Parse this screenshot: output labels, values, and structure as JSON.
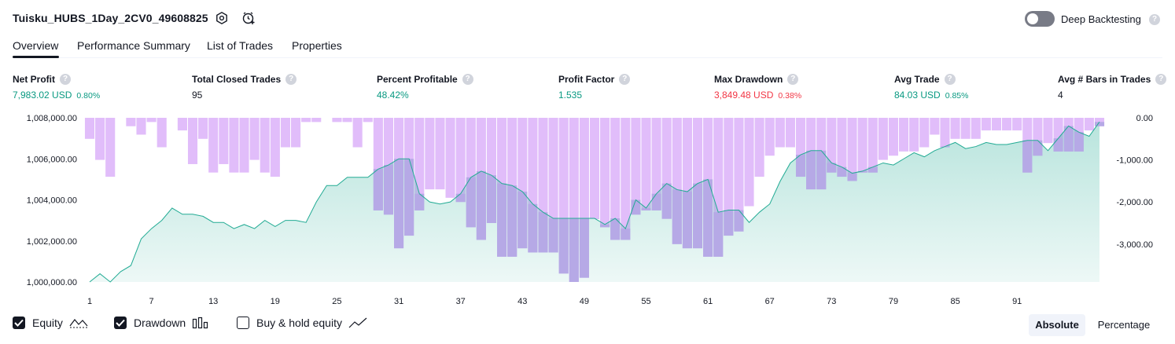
{
  "header": {
    "title": "Tuisku_HUBS_1Day_2CV0_49608825",
    "settings_icon": "gear-icon",
    "alert_icon": "add-alert-icon",
    "deep_backtesting_label": "Deep Backtesting",
    "deep_backtesting_enabled": false,
    "help_glyph": "?"
  },
  "tabs": [
    {
      "label": "Overview",
      "active": true
    },
    {
      "label": "Performance Summary",
      "active": false
    },
    {
      "label": "List of Trades",
      "active": false
    },
    {
      "label": "Properties",
      "active": false
    }
  ],
  "metrics": [
    {
      "label": "Net Profit",
      "value": "7,983.02 USD",
      "pct": "0.80%",
      "tone": "pos"
    },
    {
      "label": "Total Closed Trades",
      "value": "95",
      "pct": "",
      "tone": "neutral"
    },
    {
      "label": "Percent Profitable",
      "value": "48.42%",
      "pct": "",
      "tone": "pos"
    },
    {
      "label": "Profit Factor",
      "value": "1.535",
      "pct": "",
      "tone": "pos"
    },
    {
      "label": "Max Drawdown",
      "value": "3,849.48 USD",
      "pct": "0.38%",
      "tone": "neg"
    },
    {
      "label": "Avg Trade",
      "value": "84.03 USD",
      "pct": "0.85%",
      "tone": "pos"
    },
    {
      "label": "Avg # Bars in Trades",
      "value": "4",
      "pct": "",
      "tone": "neutral"
    }
  ],
  "chart_data": {
    "type": "line",
    "x_ticks": [
      "1",
      "7",
      "13",
      "19",
      "25",
      "31",
      "37",
      "43",
      "49",
      "55",
      "61",
      "67",
      "73",
      "79",
      "85",
      "91"
    ],
    "left_ticks": [
      "1,008,000.00",
      "1,006,000.00",
      "1,004,000.00",
      "1,002,000.00",
      "1,000,000.00"
    ],
    "right_ticks": [
      "0.00",
      "-1,000.00",
      "-2,000.00",
      "-3,000.00"
    ],
    "left_ylim": [
      1000000,
      1008000
    ],
    "right_ylim": [
      -3900,
      0
    ],
    "series": [
      {
        "name": "Equity",
        "axis": "left",
        "color": "#22ab94",
        "values": [
          1000000,
          1000400,
          1000000,
          1000500,
          1000800,
          1002100,
          1002600,
          1003000,
          1003600,
          1003300,
          1003300,
          1003200,
          1002900,
          1002900,
          1002600,
          1002800,
          1002600,
          1003000,
          1002700,
          1003000,
          1003000,
          1002900,
          1003900,
          1004700,
          1004700,
          1005100,
          1005100,
          1005100,
          1005500,
          1005700,
          1006000,
          1006000,
          1004300,
          1003900,
          1003800,
          1003900,
          1004300,
          1005100,
          1005400,
          1005200,
          1004800,
          1004700,
          1004400,
          1003800,
          1003400,
          1003100,
          1003100,
          1003100,
          1003100,
          1003100,
          1002800,
          1003100,
          1002600,
          1004000,
          1003600,
          1004300,
          1004800,
          1004500,
          1004400,
          1004800,
          1005000,
          1003400,
          1003500,
          1003500,
          1002900,
          1003400,
          1003800,
          1004900,
          1005800,
          1006200,
          1006400,
          1006400,
          1005800,
          1005600,
          1005300,
          1005400,
          1005600,
          1005800,
          1005700,
          1006000,
          1006300,
          1006100,
          1006400,
          1006600,
          1006800,
          1006500,
          1006600,
          1006800,
          1006700,
          1006700,
          1006800,
          1006900,
          1006900,
          1006400,
          1007000,
          1007600,
          1007300,
          1007100,
          1007800,
          1008000
        ]
      },
      {
        "name": "Drawdown",
        "axis": "right",
        "color": "#e1bdfa",
        "values": [
          -500,
          -1000,
          -1400,
          0,
          -200,
          -400,
          -100,
          -700,
          0,
          -300,
          -1100,
          -500,
          -1300,
          -1100,
          -1300,
          -1300,
          -1000,
          -1300,
          -1400,
          -700,
          -700,
          -100,
          -100,
          0,
          -100,
          -100,
          -700,
          -100,
          -2200,
          -2300,
          -3100,
          -2800,
          -2200,
          -1700,
          -1700,
          -1900,
          -2000,
          -2600,
          -2900,
          -2500,
          -3300,
          -3300,
          -3100,
          -3200,
          -3200,
          -3200,
          -3700,
          -3900,
          -3800,
          -2400,
          -2600,
          -2900,
          -2900,
          -2300,
          -2200,
          -2200,
          -2400,
          -3000,
          -3100,
          -3100,
          -3300,
          -3300,
          -2800,
          -2700,
          -2100,
          -1400,
          -900,
          -700,
          -700,
          -1400,
          -1700,
          -1700,
          -1300,
          -1400,
          -1500,
          -1300,
          -1300,
          -1000,
          -900,
          -800,
          -800,
          -700,
          -400,
          -700,
          -500,
          -500,
          -500,
          -300,
          -300,
          -300,
          -300,
          -1300,
          -900,
          -600,
          -800,
          -800,
          -800,
          -300,
          -200
        ]
      }
    ]
  },
  "legend": [
    {
      "label": "Equity",
      "checked": true,
      "glyph": "equity-line-icon"
    },
    {
      "label": "Drawdown",
      "checked": true,
      "glyph": "drawdown-bars-icon"
    },
    {
      "label": "Buy & hold equity",
      "checked": false,
      "glyph": "buy-hold-line-icon"
    }
  ],
  "view_modes": [
    {
      "label": "Absolute",
      "active": true
    },
    {
      "label": "Percentage",
      "active": false
    }
  ]
}
